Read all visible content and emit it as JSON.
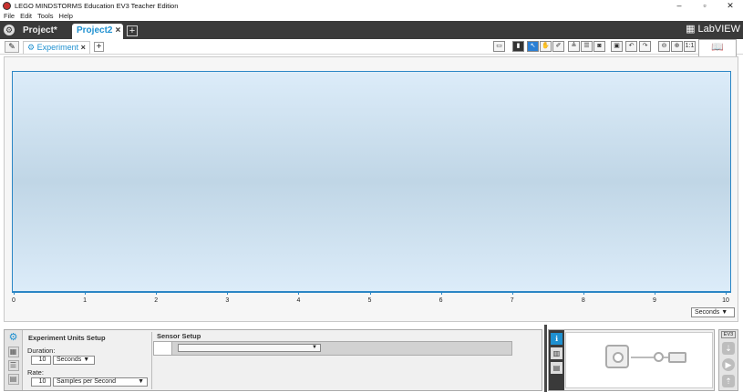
{
  "window": {
    "title": "LEGO MINDSTORMS Education EV3 Teacher Edition",
    "minimize": "–",
    "maximize": "▫",
    "close": "✕"
  },
  "menu": [
    "File",
    "Edit",
    "Tools",
    "Help"
  ],
  "projects": {
    "tabs": [
      {
        "label": "Project*",
        "active": false
      },
      {
        "label": "Project2",
        "active": true
      }
    ],
    "close_glyph": "×",
    "add_glyph": "+",
    "labview": "LabVIEW"
  },
  "toolbar": {
    "experiment_tab": "Experiment",
    "close_glyph": "×",
    "add_glyph": "+",
    "zoom_one_to_one": "1:1"
  },
  "graph": {
    "x_ticks": [
      "0",
      "1",
      "2",
      "3",
      "4",
      "5",
      "6",
      "7",
      "8",
      "9",
      "10"
    ],
    "units": "Seconds"
  },
  "experiment_setup": {
    "heading": "Experiment Units Setup",
    "duration_label": "Duration:",
    "duration_value": "10",
    "duration_unit": "Seconds",
    "rate_label": "Rate:",
    "rate_value": "10",
    "rate_unit": "Samples per Second"
  },
  "sensor_setup": {
    "heading": "Sensor Setup"
  },
  "ev3": {
    "label": "EV3"
  },
  "colors": {
    "accent": "#1e90d0",
    "dark_bar": "#3a3a3a",
    "graph_border": "#2b86c5"
  }
}
